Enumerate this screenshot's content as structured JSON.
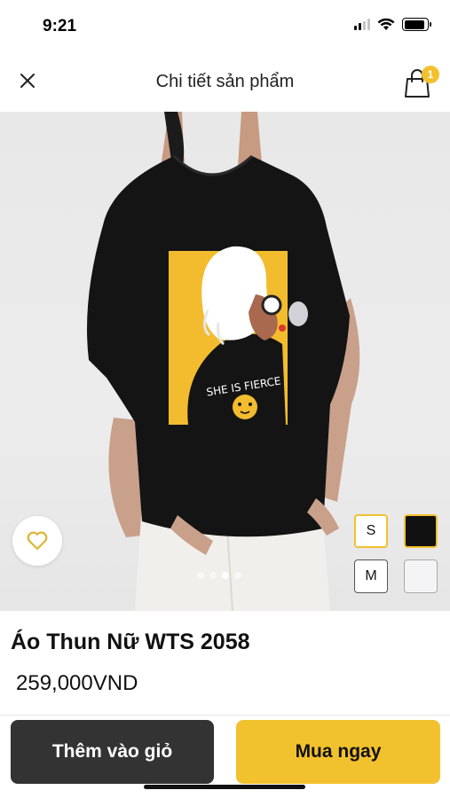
{
  "status_bar": {
    "time": "9:21",
    "icons": [
      "cellular-signal-icon",
      "wifi-icon",
      "battery-icon"
    ],
    "battery_level": 0.9
  },
  "header": {
    "title": "Chi tiết sản phẩm",
    "close_icon": "close-icon",
    "cart_icon": "shopping-bag-icon",
    "cart_count": "1"
  },
  "product": {
    "print_text": "SHE IS FIERCE",
    "name": "Áo Thun Nữ WTS 2058",
    "price": "259,000VND",
    "favorite_icon": "heart-outline-icon",
    "carousel": {
      "count": 4,
      "active_index": 2
    },
    "sizes": [
      {
        "label": "S",
        "selected": true
      },
      {
        "label": "M",
        "selected": false
      }
    ],
    "colors": [
      {
        "value": "#111111",
        "selected": true
      },
      {
        "value": "#f4f4f6",
        "selected": false
      }
    ]
  },
  "actions": {
    "add_to_cart": "Thêm vào giỏ",
    "buy_now": "Mua ngay"
  },
  "theme": {
    "accent": "#f2c12e",
    "dark_button": "#333333",
    "background": "#ffffff"
  }
}
